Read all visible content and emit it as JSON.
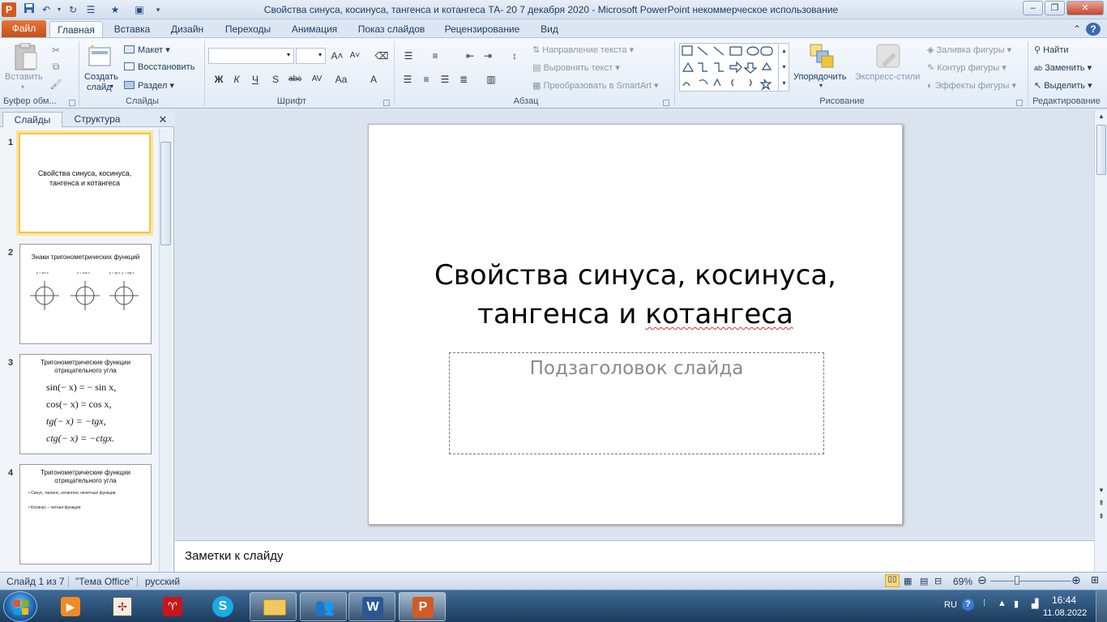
{
  "window": {
    "title": "Свойства синуса, косинуса, тангенса и котангеса ТА- 20  7 декабря 2020  -  Microsoft PowerPoint некоммерческое использование"
  },
  "tabs": {
    "file": "Файл",
    "items": [
      "Главная",
      "Вставка",
      "Дизайн",
      "Переходы",
      "Анимация",
      "Показ слайдов",
      "Рецензирование",
      "Вид"
    ]
  },
  "ribbon": {
    "clipboard": {
      "paste": "Вставить",
      "label": "Буфер обм..."
    },
    "slides": {
      "new_slide_1": "Создать",
      "new_slide_2": "слайд",
      "layout": "Макет",
      "reset": "Восстановить",
      "section": "Раздел",
      "label": "Слайды"
    },
    "font": {
      "label": "Шрифт",
      "bold": "Ж",
      "italic": "К",
      "underline": "Ч",
      "shadow": "S",
      "strike": "abc",
      "spacing": "AV",
      "case": "Aa",
      "color": "A"
    },
    "paragraph": {
      "text_direction": "Направление текста",
      "align_text": "Выровнять текст",
      "smartart": "Преобразовать в SmartArt",
      "label": "Абзац"
    },
    "drawing": {
      "arrange": "Упорядочить",
      "quick_styles": "Экспресс-стили",
      "fill": "Заливка фигуры",
      "outline": "Контур фигуры",
      "effects": "Эффекты фигуры",
      "label": "Рисование"
    },
    "editing": {
      "find": "Найти",
      "replace": "Заменить",
      "select": "Выделить",
      "label": "Редактирование"
    }
  },
  "pane": {
    "tab_slides": "Слайды",
    "tab_outline": "Структура"
  },
  "thumbs": [
    {
      "num": "1",
      "title": "Свойства синуса, косинуса, тангенса и котангеса"
    },
    {
      "num": "2",
      "title": "Знаки тригонометрических функций",
      "sub": [
        "y = sin x",
        "y = cos x",
        "y = tg x, y = ctg x"
      ]
    },
    {
      "num": "3",
      "title": "Тригонометрические функции отрицательного угла",
      "lines": [
        "sin(− x) = − sin x,",
        "cos(− x) = cos x,",
        "tg(− x) = −tgx,",
        "ctg(− x) = −ctgx."
      ]
    },
    {
      "num": "4",
      "title": "Тригонометрические функции отрицательного угла",
      "bullets": [
        "Синус, тангенс, котангенс нечетные функции",
        "Косинус – четная функция"
      ]
    }
  ],
  "slide": {
    "title_line1": "Свойства синуса, косинуса,",
    "title_line2_a": "тангенса и ",
    "title_line2_b": "котангеса",
    "subtitle_placeholder": "Подзаголовок слайда"
  },
  "notes": {
    "placeholder": "Заметки к слайду"
  },
  "status": {
    "slide": "Слайд 1 из 7",
    "theme": "\"Тема Office\"",
    "lang": "русский",
    "zoom": "69%",
    "zoom_value": 0.69
  },
  "taskbar": {
    "lang": "RU",
    "time": "16:44",
    "date": "11.08.2022"
  },
  "colors": {
    "file_tab": "#d35a24",
    "selection": "#f4c542",
    "spellcheck": "#e03030"
  }
}
